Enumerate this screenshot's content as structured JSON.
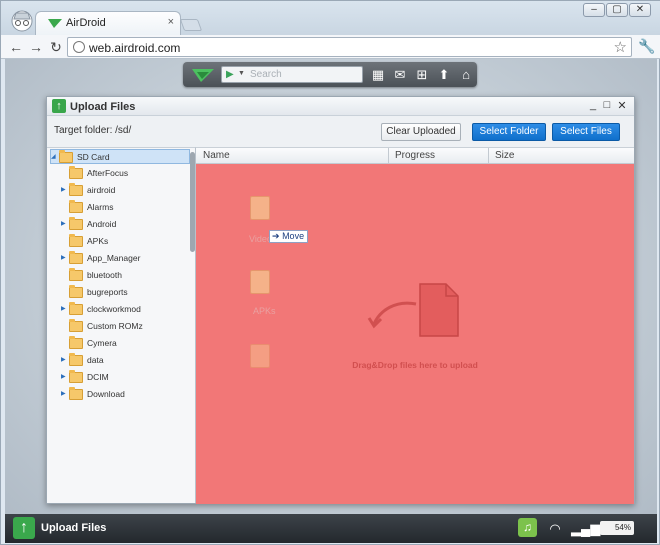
{
  "browser": {
    "tab_title": "AirDroid",
    "tab_close": "×",
    "address": "web.airdroid.com",
    "window_controls": [
      "–",
      "▢",
      "✕"
    ]
  },
  "airdroid_bar": {
    "search_placeholder": "Search"
  },
  "upload_window": {
    "title": "Upload Files",
    "target_folder": "Target folder: /sd/",
    "buttons": {
      "clear_uploaded": "Clear Uploaded",
      "select_folder": "Select Folder",
      "select_files": "Select Files"
    },
    "columns": [
      "Name",
      "Progress",
      "Size"
    ],
    "tree": [
      {
        "label": "SD Card",
        "expandable": true,
        "selected": true
      },
      {
        "label": "AfterFocus",
        "expandable": false
      },
      {
        "label": "airdroid",
        "expandable": true
      },
      {
        "label": "Alarms",
        "expandable": false
      },
      {
        "label": "Android",
        "expandable": true
      },
      {
        "label": "APKs",
        "expandable": false
      },
      {
        "label": "App_Manager",
        "expandable": true
      },
      {
        "label": "bluetooth",
        "expandable": false
      },
      {
        "label": "bugreports",
        "expandable": false
      },
      {
        "label": "clockworkmod",
        "expandable": true
      },
      {
        "label": "Custom ROMz",
        "expandable": false
      },
      {
        "label": "Cymera",
        "expandable": false
      },
      {
        "label": "data",
        "expandable": true
      },
      {
        "label": "DCIM",
        "expandable": true
      },
      {
        "label": "Download",
        "expandable": true
      }
    ],
    "drop_hint": "Drag&Drop files here to upload",
    "dragged_items": [
      "Video",
      "APKs"
    ],
    "move_tag": "Move"
  },
  "taskbar": {
    "label": "Upload Files",
    "battery": "54%"
  },
  "colors": {
    "drop_zone": "#f27777",
    "accent_blue": "#0f6fcb",
    "accent_green": "#39a64b"
  }
}
